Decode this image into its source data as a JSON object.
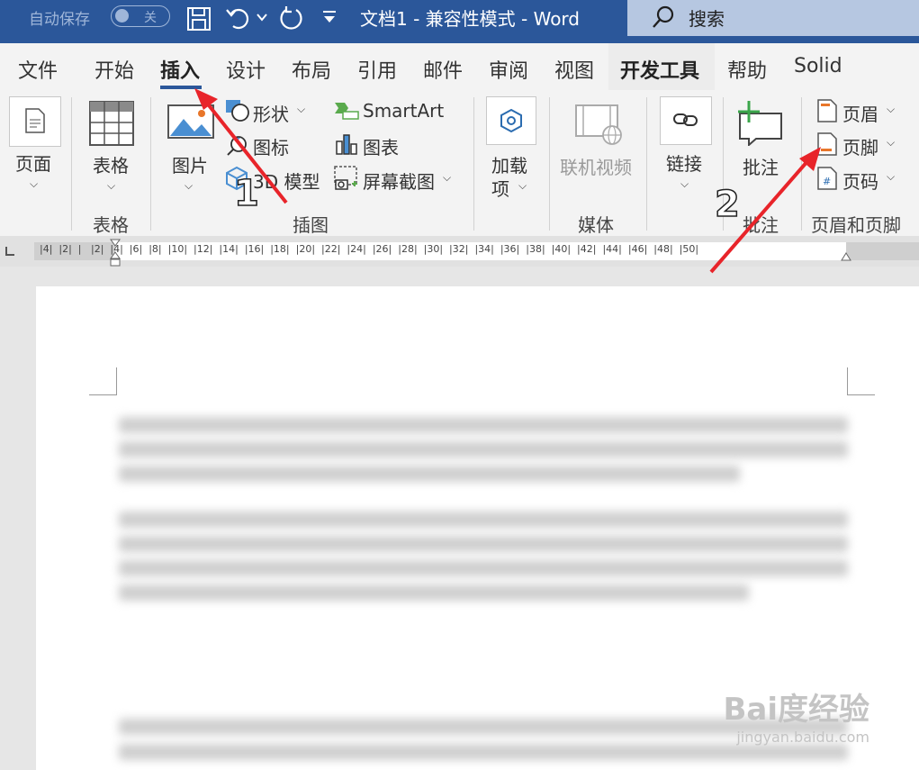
{
  "titlebar": {
    "autosave_label": "自动保存",
    "autosave_state": "关",
    "doc_title": "文档1  -  兼容性模式  -  Word",
    "search_label": "搜索"
  },
  "tabs": [
    {
      "label": "文件"
    },
    {
      "label": "开始"
    },
    {
      "label": "插入"
    },
    {
      "label": "设计"
    },
    {
      "label": "布局"
    },
    {
      "label": "引用"
    },
    {
      "label": "邮件"
    },
    {
      "label": "审阅"
    },
    {
      "label": "视图"
    },
    {
      "label": "开发工具"
    },
    {
      "label": "帮助"
    },
    {
      "label": "Solid"
    }
  ],
  "ribbon": {
    "page_btn": "页面",
    "table_btn": "表格",
    "table_group": "表格",
    "picture_btn": "图片",
    "shapes_btn": "形状",
    "icons_btn": "图标",
    "model3d_btn": "3D 模型",
    "smartart_btn": "SmartArt",
    "chart_btn": "图表",
    "screenshot_btn": "屏幕截图",
    "illustrations_group": "插图",
    "addins_btn_line1": "加载",
    "addins_btn_line2": "项",
    "online_video_btn": "联机视频",
    "media_group": "媒体",
    "link_btn": "链接",
    "comment_btn": "批注",
    "comment_group": "批注",
    "header_btn": "页眉",
    "footer_btn": "页脚",
    "pagenum_btn": "页码",
    "header_footer_group": "页眉和页脚"
  },
  "ruler": {
    "numbers": "|4|  |2|  |   |2|  |4|  |6|  |8|  |10|  |12|  |14|  |16|  |18|  |20|  |22|  |24|  |26|  |28|  |30|  |32|  |34|  |36|  |38|  |40|  |42|  |44|  |46|  |48|  |50|"
  },
  "annotations": {
    "step1": "1",
    "step2": "2"
  },
  "watermark": {
    "brand": "Bai度经验",
    "url": "jingyan.baidu.com"
  },
  "colors": {
    "titlebar": "#2b579a",
    "arrow": "#e8242a"
  }
}
